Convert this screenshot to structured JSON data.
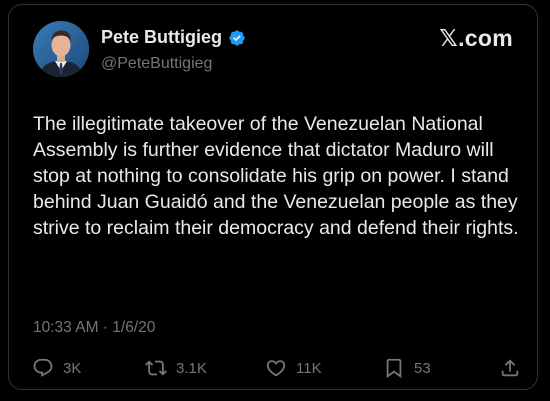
{
  "author": {
    "name": "Pete Buttigieg",
    "handle": "@PeteButtigieg",
    "verified": true
  },
  "brand": "𝕏.com",
  "tweet": {
    "text": "The illegitimate takeover of the Venezuelan National Assembly is further evidence that dictator Maduro will stop at nothing to consolidate his grip on power. I stand behind Juan Guaidó and the Venezuelan people as they strive to reclaim their democracy and defend their rights.",
    "timestamp": "10:33 AM · 1/6/20"
  },
  "actions": {
    "replies": "3K",
    "reposts": "3.1K",
    "likes": "11K",
    "bookmarks": "53"
  },
  "icons": {
    "verified": "verified-badge-icon",
    "reply": "speech-bubble-icon",
    "repost": "repost-arrows-icon",
    "like": "heart-icon",
    "bookmark": "bookmark-icon",
    "share": "share-upload-icon"
  },
  "colors": {
    "background": "#000000",
    "primary_text": "#e7e9ea",
    "secondary_text": "#71767b",
    "verified_badge": "#1d9bf0",
    "border": "#2f3336"
  }
}
